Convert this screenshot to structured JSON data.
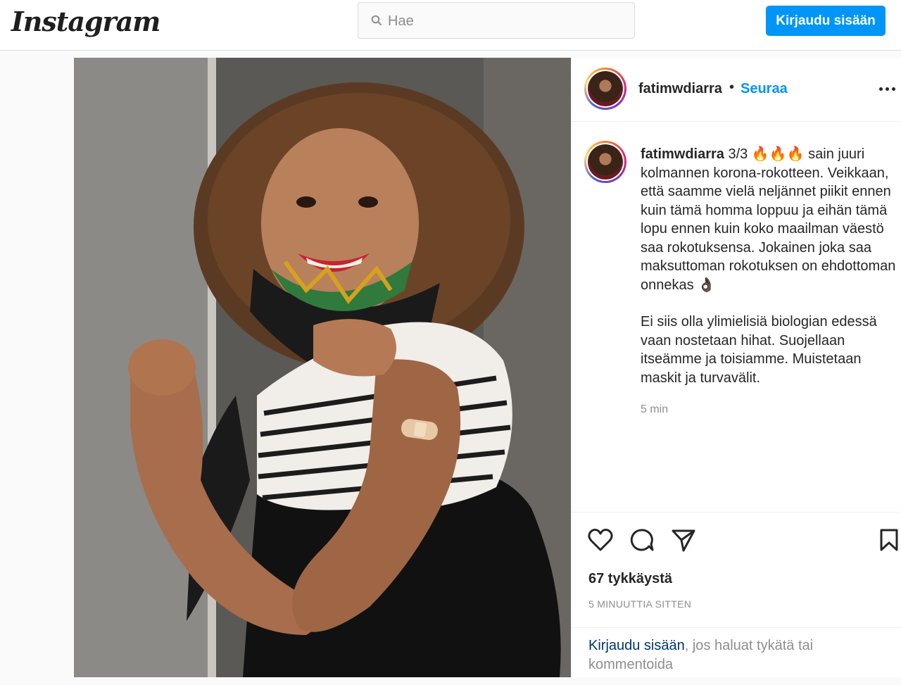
{
  "header": {
    "logo_text": "Instagram",
    "search_placeholder": "Hae",
    "login_label": "Kirjaudu sisään"
  },
  "post": {
    "username": "fatimwdiarra",
    "separator": "•",
    "follow_label": "Seuraa",
    "photo_icon": "photo-of-woman-showing-vaccinated-arm",
    "caption_part1": "3/3 🔥🔥🔥 sain juuri kolmannen korona-rokotteen. Veikkaan, että saamme vielä neljännet piikit ennen kuin tämä homma loppuu ja eihän tämä lopu ennen kuin koko maailman väestö saa rokotuksensa. Jokainen joka saa maksuttoman rokotuksen on ehdottoman onnekas 👌🏿",
    "caption_part2": "Ei siis olla ylimielisiä biologian edessä vaan nostetaan hihat. Suojellaan itseämme ja toisiamme. Muistetaan maskit ja turvavälit.",
    "caption_time": "5 min",
    "likes": "67 tykkäystä",
    "posted_ago": "5 MINUUTTIA SITTEN",
    "login_prompt_link": "Kirjaudu sisään",
    "login_prompt_rest": ", jos haluat tykätä tai kommentoida"
  },
  "colors": {
    "accent": "#0095f6",
    "text": "#262626",
    "muted": "#8e8e8e"
  }
}
